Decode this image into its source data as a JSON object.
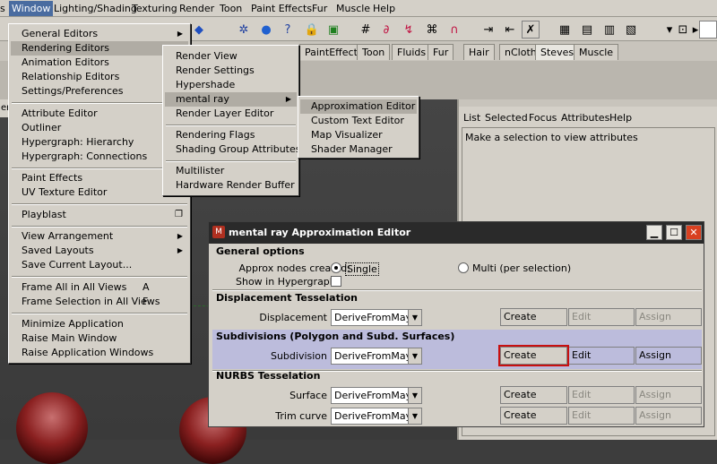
{
  "menubar": {
    "items": [
      "Window",
      "Lighting/Shading",
      "Texturing",
      "Render",
      "Toon",
      "Paint Effects",
      "Fur",
      "Muscle",
      "Help"
    ],
    "cut_left": "s"
  },
  "shelf_tabs": [
    "PaintEffects",
    "Toon",
    "Fluids",
    "Fur",
    "Hair",
    "nCloth",
    "Steves",
    "Muscle"
  ],
  "window_menu": {
    "group1": [
      "General Editors",
      "Rendering Editors",
      "Animation Editors",
      "Relationship Editors",
      "Settings/Preferences"
    ],
    "group2": [
      "Attribute Editor",
      "Outliner",
      "Hypergraph: Hierarchy",
      "Hypergraph: Connections"
    ],
    "group3": [
      "Paint Effects",
      "UV Texture Editor"
    ],
    "group4": [
      "Playblast"
    ],
    "group5": [
      "View Arrangement",
      "Saved Layouts",
      "Save Current Layout..."
    ],
    "group6": [
      "Frame All in All Views",
      "Frame Selection in All Views"
    ],
    "group6_accels": [
      "A",
      "F"
    ],
    "group7": [
      "Minimize Application",
      "Raise Main Window",
      "Raise Application Windows"
    ]
  },
  "rendering_menu": {
    "group1": [
      "Render View",
      "Render Settings",
      "Hypershade",
      "mental ray",
      "Render Layer Editor"
    ],
    "group2": [
      "Rendering Flags",
      "Shading Group Attributes"
    ],
    "group3": [
      "Multilister",
      "Hardware Render Buffer"
    ]
  },
  "mentalray_menu": [
    "Approximation Editor",
    "Custom Text Editor",
    "Map Visualizer",
    "Shader Manager"
  ],
  "left_cap": "ence",
  "attribute_editor": {
    "menu": [
      "List",
      "Selected",
      "Focus",
      "Attributes",
      "Help"
    ],
    "message": "Make a selection to view attributes"
  },
  "approx_editor": {
    "title": "mental ray Approximation Editor",
    "general": {
      "heading": "General options",
      "approx_label": "Approx nodes created:",
      "single": "Single",
      "multi": "Multi (per selection)",
      "hypergraph": "Show in Hypergraph"
    },
    "displacement": {
      "heading": "Displacement Tesselation",
      "label": "Displacement",
      "value": "DeriveFromMaya"
    },
    "subdivisions": {
      "heading": "Subdivisions (Polygon and Subd. Surfaces)",
      "label": "Subdivision",
      "value": "DeriveFromMaya"
    },
    "nurbs": {
      "heading": "NURBS Tesselation",
      "surface_label": "Surface",
      "surface_value": "DeriveFromMaya",
      "trim_label": "Trim curve",
      "trim_value": "DeriveFromMaya"
    },
    "buttons": {
      "create": "Create",
      "edit": "Edit",
      "assign": "Assign"
    }
  },
  "colors": {
    "highlight": "#c81010",
    "selection_bg": "#bcbcdc",
    "menu_bg": "#d4d0c8"
  }
}
